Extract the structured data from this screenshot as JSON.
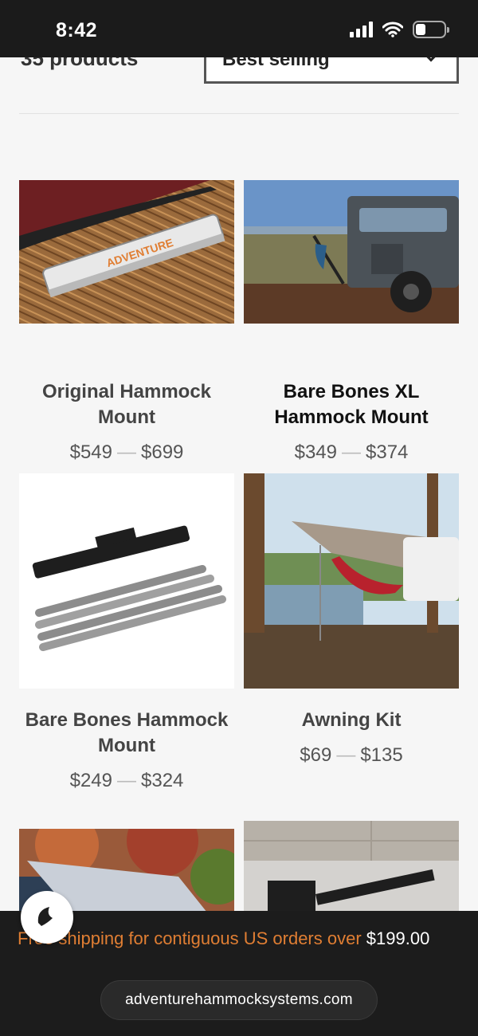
{
  "status": {
    "time": "8:42",
    "battery_level": 0.35
  },
  "collection": {
    "count_label": "35 products",
    "sort_value": "Best selling"
  },
  "products": [
    {
      "title": "Original Hammock Mount",
      "price_min": "$549",
      "price_max": "$699"
    },
    {
      "title": "Bare Bones XL Hammock Mount",
      "price_min": "$349",
      "price_max": "$374"
    },
    {
      "title": "Bare Bones Hammock Mount",
      "price_min": "$249",
      "price_max": "$324"
    },
    {
      "title": "Awning Kit",
      "price_min": "$69",
      "price_max": "$135"
    }
  ],
  "price_separator": "—",
  "announcement": {
    "text": "Free shipping for contiguous US orders over ",
    "amount": "$199.00"
  },
  "browser": {
    "url": "adventurehammocksystems.com"
  },
  "colors": {
    "accent": "#e07e33",
    "bar_bg": "#1c1c1c"
  }
}
